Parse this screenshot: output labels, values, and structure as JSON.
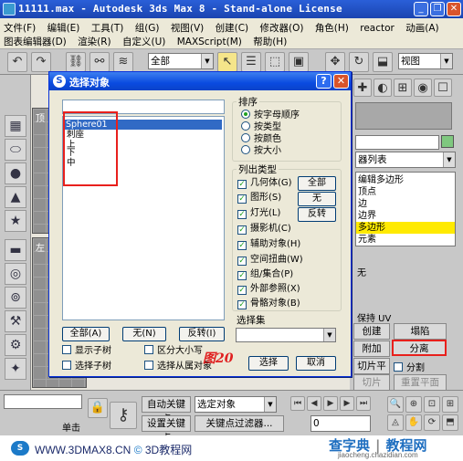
{
  "window": {
    "title": "11111.max - Autodesk 3ds Max 8 - Stand-alone License"
  },
  "menu": {
    "row1": [
      "文件(F)",
      "编辑(E)",
      "工具(T)",
      "组(G)",
      "视图(V)",
      "创建(C)",
      "修改器(O)",
      "角色(H)",
      "reactor",
      "动画(A)"
    ],
    "row2": [
      "图表编辑器(D)",
      "渲染(R)",
      "自定义(U)",
      "MAXScript(M)",
      "帮助(H)"
    ]
  },
  "toolbar": {
    "filter": "全部",
    "refcoord": "视图"
  },
  "viewports": {
    "top": "顶",
    "left": "左"
  },
  "dialog": {
    "title": "选择对象",
    "objects": [
      "Sphere01",
      "刺座",
      "上",
      "下",
      "中"
    ],
    "buttons": {
      "all": "全部(A)",
      "none": "无(N)",
      "invert": "反转(I)"
    },
    "checks": {
      "show_children": "显示子树",
      "select_children": "选择子树",
      "case_sensitive": "区分大小写",
      "select_dependents": "选择从属对象"
    },
    "sort": {
      "label": "排序",
      "options": [
        "按字母顺序",
        "按类型",
        "按颜色",
        "按大小"
      ]
    },
    "list_types": {
      "label": "列出类型",
      "items": [
        "几何体(G)",
        "图形(S)",
        "灯光(L)",
        "摄影机(C)",
        "辅助对象(H)",
        "空间扭曲(W)",
        "组/集合(P)",
        "外部参照(X)",
        "骨骼对象(B)"
      ],
      "all": "全部",
      "none": "无",
      "invert": "反转"
    },
    "selection_set": {
      "label": "选择集"
    },
    "select_button": "选择",
    "cancel_button": "取消",
    "annotation": "图20"
  },
  "right_panel": {
    "list_label": "器列表",
    "stack": [
      "编辑多边形",
      "顶点",
      "边",
      "边界",
      "多边形",
      "元素"
    ],
    "sel": "无",
    "keep_uv": "保持 UV",
    "create": "创建",
    "collapse": "塌陷",
    "attach": "附加",
    "detach": "分离",
    "slice_plane": "切片平面",
    "split": "分割",
    "slice": "切片",
    "reset_plane": "重置平面"
  },
  "bottom": {
    "auto_key": "自动关键点",
    "key_combo": "选定对象",
    "set_key": "设置关键点",
    "key_filters": "关键点过滤器...",
    "frame": "0",
    "click_text": "单击"
  },
  "footer": {
    "website": "WWW.3DMAX8.CN",
    "site_name": "3D教程网",
    "brand": "查字典",
    "brand2": "教程网",
    "brand_url": "jiaocheng.chazidian.com"
  }
}
